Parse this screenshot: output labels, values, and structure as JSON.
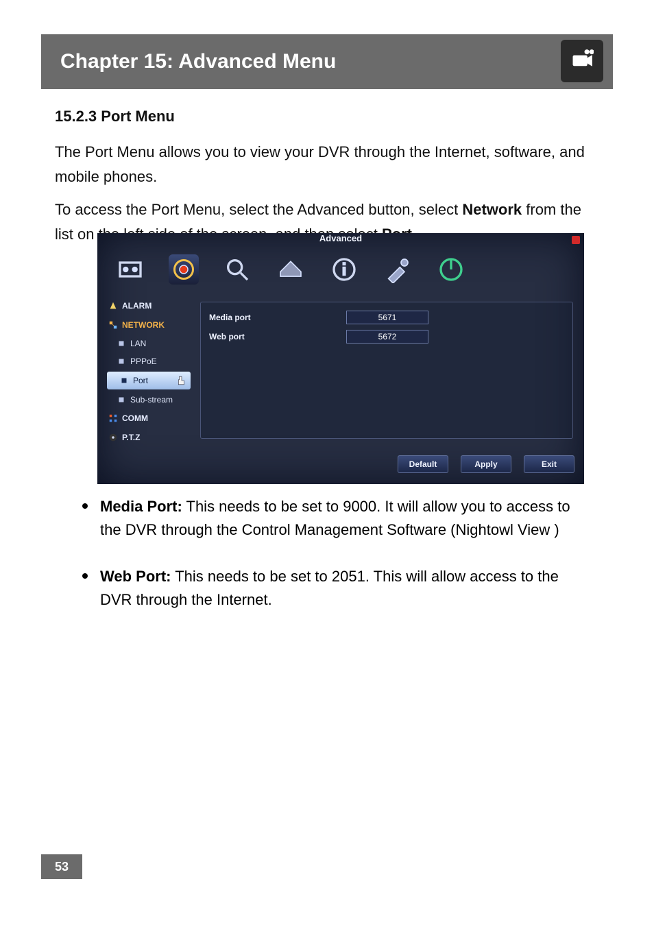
{
  "header": {
    "title": "Chapter 15: Advanced Menu",
    "icon": "camera-icon"
  },
  "section": {
    "number": "15.2.3",
    "title": "Port Menu",
    "para1": "The Port Menu allows you to view your DVR through the Internet, software, and mobile phones.",
    "para2_pre": "To access the Port Menu, select the Advanced button, select ",
    "para2_bold1": "Network",
    "para2_mid": " from the list on the left side of the screen, and then select ",
    "para2_bold2": "Port."
  },
  "screenshot": {
    "title": "Advanced",
    "tabs": [
      "tuner",
      "record",
      "search",
      "hdd",
      "info",
      "tools",
      "power"
    ],
    "sidebar": {
      "alarm": "ALARM",
      "network": "NETWORK",
      "lan": "LAN",
      "pppoe": "PPPoE",
      "port": "Port",
      "substream": "Sub-stream",
      "comm": "COMM",
      "ptz": "P.T.Z"
    },
    "fields": {
      "media_port_label": "Media port",
      "media_port_value": "5671",
      "web_port_label": "Web port",
      "web_port_value": "5672"
    },
    "buttons": {
      "default": "Default",
      "apply": "Apply",
      "exit": "Exit"
    }
  },
  "bullets": {
    "b1_label": "Media Port:",
    "b1_text": " This needs to be set to 9000. It will allow you to access to the DVR through the Control Management Software (Nightowl View )",
    "b2_label": "Web Port:",
    "b2_text": " This needs to be set to 2051. This will allow access to the DVR through the Internet."
  },
  "page_number": "53"
}
